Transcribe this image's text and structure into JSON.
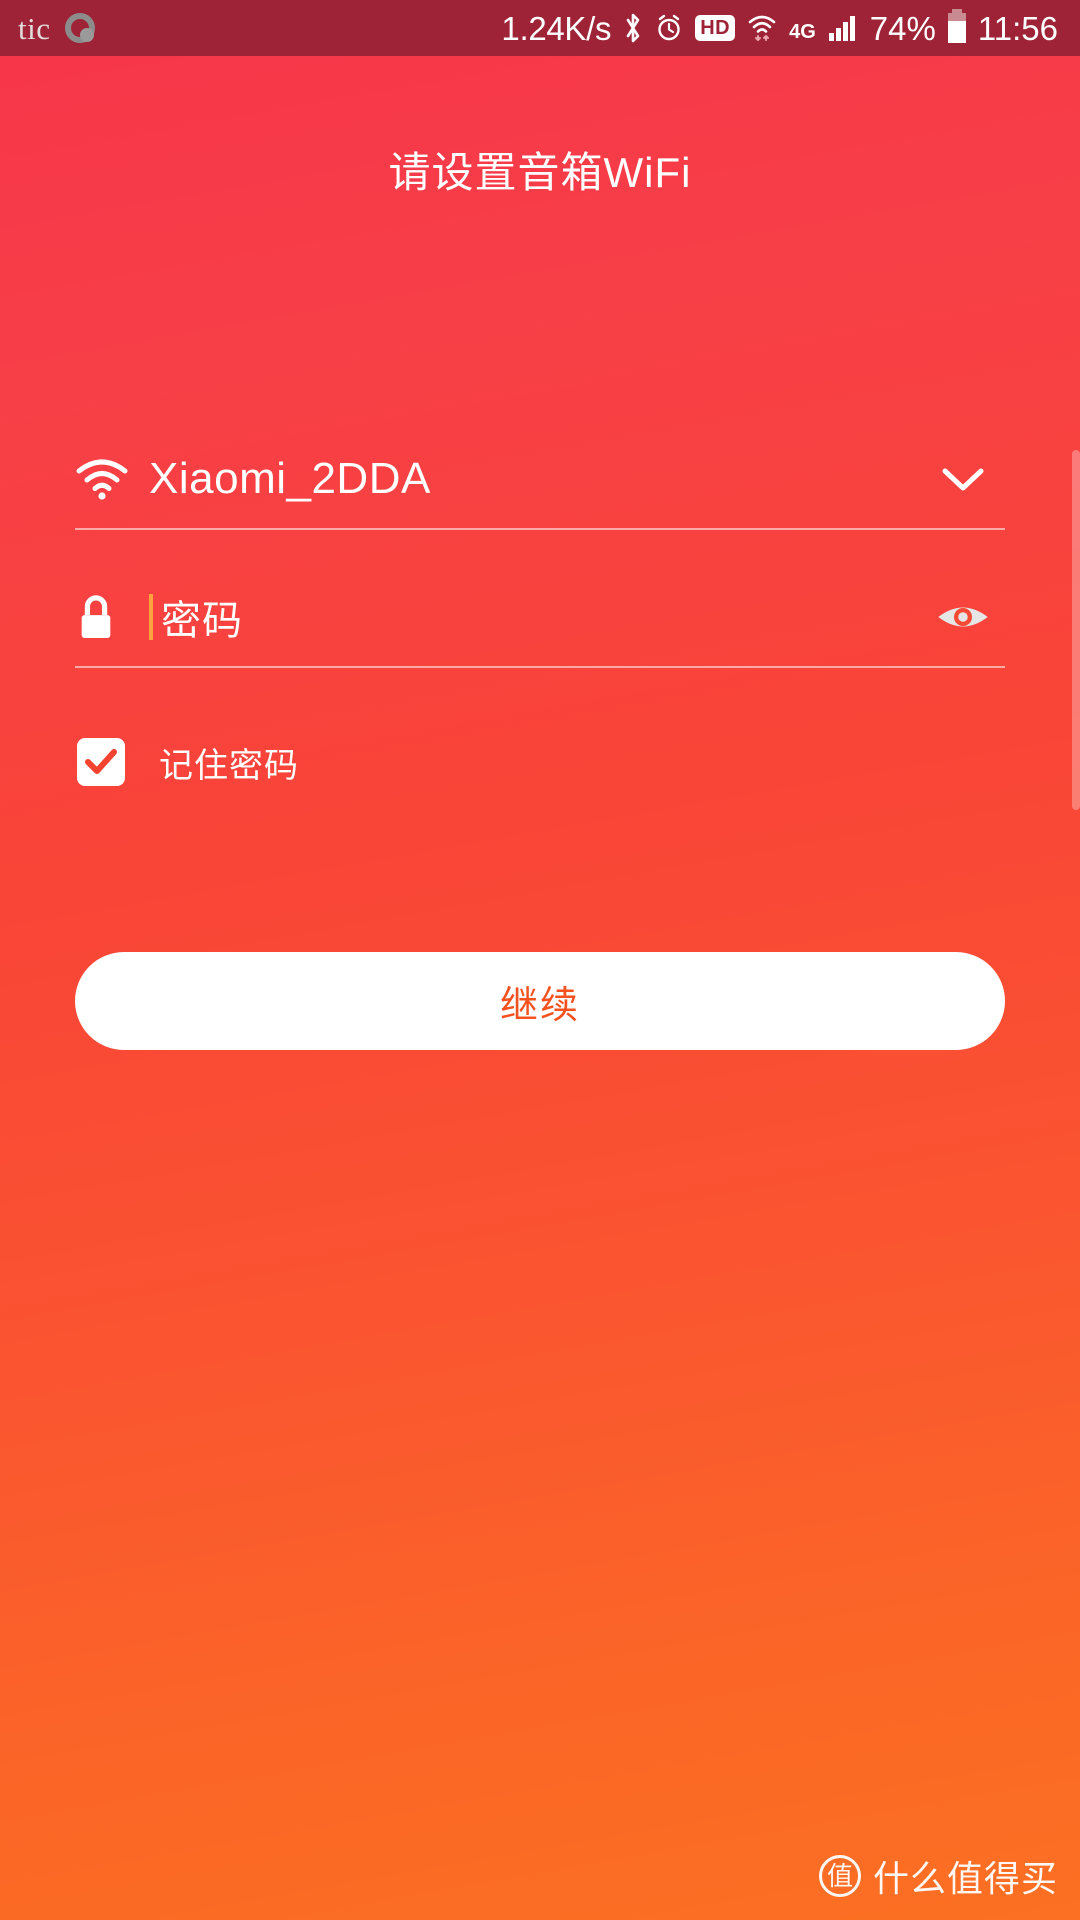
{
  "status_bar": {
    "carrier": "tic",
    "carrier_logo_icon": "tic-circle-logo",
    "network_speed": "1.24K/s",
    "bluetooth_icon": "bluetooth-icon",
    "alarm_icon": "alarm-clock-icon",
    "hd_badge": "HD",
    "wifi_icon": "wifi-icon",
    "network_type": "4G",
    "signal_icon": "cellular-signal-icon",
    "battery_percent": "74%",
    "battery_icon": "battery-icon",
    "clock": "11:56",
    "background_color": "#9e2336"
  },
  "page": {
    "title": "请设置音箱WiFi",
    "background_gradient_from": "#f7344a",
    "background_gradient_to": "#fb7022"
  },
  "form": {
    "ssid_field": {
      "icon": "wifi-icon",
      "value": "Xiaomi_2DDA",
      "dropdown_icon": "chevron-down-icon"
    },
    "password_field": {
      "icon": "lock-icon",
      "value": "",
      "placeholder": "密码",
      "caret_color": "#ffa33c",
      "reveal_icon": "eye-icon"
    },
    "remember_password": {
      "label": "记住密码",
      "checked": true,
      "check_icon": "check-icon",
      "check_color": "#f4432e"
    }
  },
  "actions": {
    "continue_label": "继续",
    "continue_text_color": "#f4511e",
    "continue_background": "#ffffff"
  },
  "watermark": {
    "logo_text": "值",
    "text": "什么值得买"
  }
}
